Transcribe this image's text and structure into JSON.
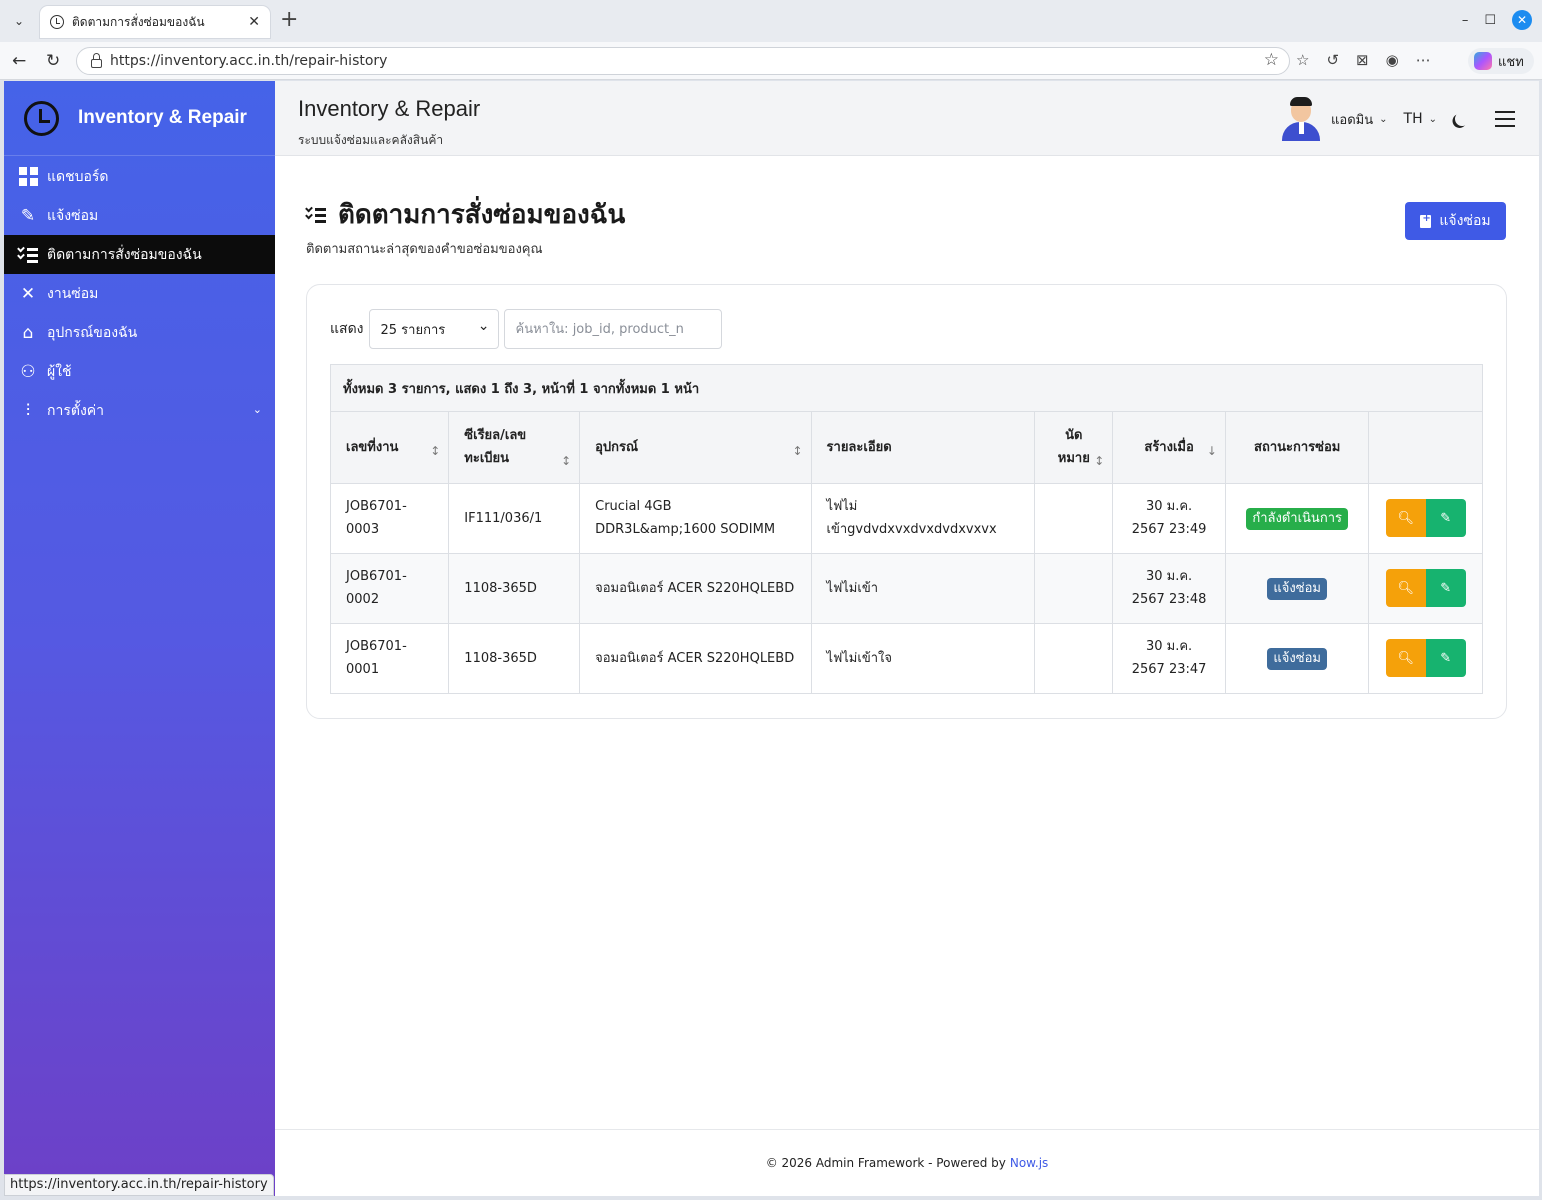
{
  "browser": {
    "tab_title": "ติดตามการสั่งซ่อมของฉัน",
    "url": "https://inventory.acc.in.th/repair-history",
    "copilot_label": "แชท",
    "status_url": "https://inventory.acc.in.th/repair-history"
  },
  "sidebar": {
    "brand": "Inventory & Repair",
    "items": [
      {
        "label": "แดชบอร์ด",
        "icon": "dashboard-icon"
      },
      {
        "label": "แจ้งซ่อม",
        "icon": "report-icon"
      },
      {
        "label": "ติดตามการสั่งซ่อมของฉัน",
        "icon": "list-check-icon",
        "active": true
      },
      {
        "label": "งานซ่อม",
        "icon": "tools-icon"
      },
      {
        "label": "อุปกรณ์ของฉัน",
        "icon": "store-icon"
      },
      {
        "label": "ผู้ใช้",
        "icon": "users-icon"
      },
      {
        "label": "การตั้งค่า",
        "icon": "sliders-icon"
      }
    ]
  },
  "header": {
    "title": "Inventory & Repair",
    "subtitle": "ระบบแจ้งซ่อมและคลังสินค้า",
    "user_name": "แอดมิน",
    "language": "TH"
  },
  "page": {
    "title": "ติดตามการสั่งซ่อมของฉัน",
    "subtitle": "ติดตามสถานะล่าสุดของคำขอซ่อมของคุณ",
    "report_button": "แจ้งซ่อม"
  },
  "table_controls": {
    "show_label": "แสดง",
    "page_size": "25 รายการ",
    "search_placeholder": "ค้นหาใน: job_id, product_n",
    "summary": "ทั้งหมด 3 รายการ, แสดง 1 ถึง 3, หน้าที่ 1 จากทั้งหมด 1 หน้า"
  },
  "table": {
    "headers": {
      "job_id": "เลขที่งาน",
      "serial": "ซีเรียล/เลขทะเบียน",
      "product": "อุปกรณ์",
      "detail": "รายละเอียด",
      "appointment": "นัดหมาย",
      "created": "สร้างเมื่อ",
      "status": "สถานะการซ่อม"
    },
    "rows": [
      {
        "job_id": "JOB6701-0003",
        "serial": "IF111/036/1",
        "product": "Crucial 4GB DDR3L&amp;1600 SODIMM",
        "detail": "ไฟไม่เข้าgvdvdxvxdvxdvdxvxvx",
        "appointment": "",
        "created": "30 ม.ค. 2567 23:49",
        "status": "กำลังดำเนินการ",
        "status_color": "#27ae4a"
      },
      {
        "job_id": "JOB6701-0002",
        "serial": "1108-365D",
        "product": "จอมอนิเตอร์ ACER S220HQLEBD",
        "detail": "ไฟไม่เข้า",
        "appointment": "",
        "created": "30 ม.ค. 2567 23:48",
        "status": "แจ้งซ่อม",
        "status_color": "#3f6c9c"
      },
      {
        "job_id": "JOB6701-0001",
        "serial": "1108-365D",
        "product": "จอมอนิเตอร์ ACER S220HQLEBD",
        "detail": "ไฟไม่เข้าใจ",
        "appointment": "",
        "created": "30 ม.ค. 2567 23:47",
        "status": "แจ้งซ่อม",
        "status_color": "#3f6c9c"
      }
    ]
  },
  "footer": {
    "text": "© 2026 Admin Framework - Powered by",
    "link": "Now.js"
  }
}
